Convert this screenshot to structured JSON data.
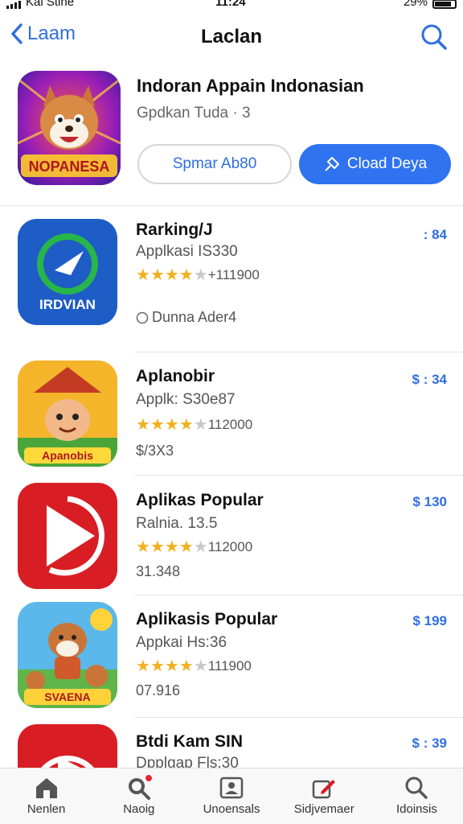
{
  "status": {
    "carrier": "Kai Stine",
    "time": "11:24",
    "battery": "29%"
  },
  "nav": {
    "back_label": "Laam",
    "title": "Laclan"
  },
  "featured": {
    "icon_text": "NOPANESA",
    "title": "Indoran Appain Indonasian",
    "subtitle": "Gpdkan Tuda · 3",
    "secondary_button": "Spmar Ab80",
    "primary_button": "Cload Deya"
  },
  "apps": [
    {
      "name": "Rarking/J",
      "sub": "Applkasi IS330",
      "rating_stars": 4,
      "rating_count": "+111900",
      "extra": "Dunna Ader4",
      "price": ": 84",
      "icon_text": "IRDVIAN"
    },
    {
      "name": "Aplanobir",
      "sub": "Applk: S30e87",
      "rating_stars": 4,
      "rating_count": "112000",
      "extra": "$/3X3",
      "price": "$ : 34",
      "icon_text": "Apanobis"
    },
    {
      "name": "Aplikas Popular",
      "sub": "Ralnia. 13.5",
      "rating_stars": 4,
      "rating_count": "112000",
      "extra": "31.348",
      "price": "$ 130",
      "icon_text": ""
    },
    {
      "name": "Aplikasis Popular",
      "sub": "Appkai Hs:36",
      "rating_stars": 4,
      "rating_count": "111900",
      "extra": "07.916",
      "price": "$ 199",
      "icon_text": "SVAENA"
    },
    {
      "name": "Btdi Kam SIN",
      "sub": "Dpplgap Fls:30",
      "rating_stars": 0,
      "rating_count": "",
      "extra": "",
      "price": "$ : 39",
      "icon_text": ""
    }
  ],
  "tabs": [
    {
      "label": "Nenlen",
      "icon": "home-icon"
    },
    {
      "label": "Naoig",
      "icon": "search-badge-icon"
    },
    {
      "label": "Unoensals",
      "icon": "photo-icon"
    },
    {
      "label": "Sidjvemaer",
      "icon": "pencil-icon"
    },
    {
      "label": "Idoinsis",
      "icon": "search-icon"
    }
  ],
  "colors": {
    "accent": "#2f73f0",
    "star": "#f2b01e",
    "badge": "#e8262e"
  }
}
